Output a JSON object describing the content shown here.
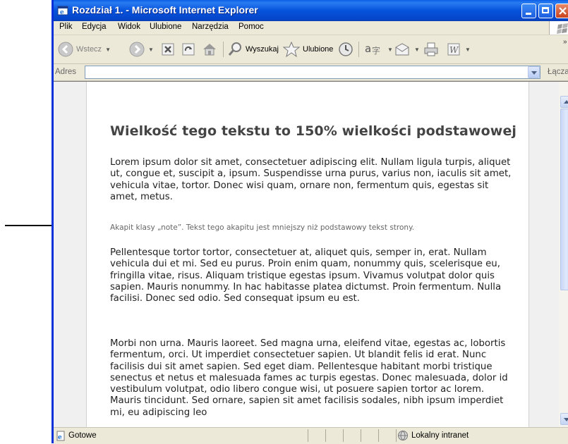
{
  "window": {
    "title": "Rozdział 1. - Microsoft Internet Explorer"
  },
  "menu": {
    "items": [
      "Plik",
      "Edycja",
      "Widok",
      "Ulubione",
      "Narzędzia",
      "Pomoc"
    ]
  },
  "toolbar": {
    "back_label": "Wstecz",
    "search_label": "Wyszukaj",
    "favorites_label": "Ulubione"
  },
  "address": {
    "label": "Adres",
    "value": "",
    "go_label": "Łącza"
  },
  "page": {
    "heading": "Wielkość tego tekstu to 150% wielkości podstawowej",
    "paragraph1": "Lorem ipsum dolor sit amet, consectetuer adipiscing elit. Nullam ligula turpis, aliquet ut, congue et, suscipit a, ipsum. Suspendisse urna purus, varius non, iaculis sit amet, vehicula vitae, tortor. Donec wisi quam, ornare non, fermentum quis, egestas sit amet, metus.",
    "note": "Akapit klasy „note”. Tekst tego akapitu jest mniejszy niż podstawowy tekst strony.",
    "paragraph2": "Pellentesque tortor tortor, consectetuer at, aliquet quis, semper in, erat. Nullam vehicula dui et mi. Sed eu purus. Proin enim quam, nonummy quis, scelerisque eu, fringilla vitae, risus. Aliquam tristique egestas ipsum. Vivamus volutpat dolor quis sapien. Mauris nonummy. In hac habitasse platea dictumst. Proin fermentum. Nulla facilisi. Donec sed odio. Sed consequat ipsum eu est.",
    "paragraph3": "Morbi non urna. Mauris laoreet. Sed magna urna, eleifend vitae, egestas ac, lobortis fermentum, orci. Ut imperdiet consectetuer sapien. Ut blandit felis id erat. Nunc facilisis dui sit amet sapien. Sed eget diam. Pellentesque habitant morbi tristique senectus et netus et malesuada fames ac turpis egestas. Donec malesuada, dolor id vestibulum volutpat, odio libero congue wisi, ut posuere sapien tortor ac lorem. Mauris tincidunt. Sed ornare, sapien sit amet facilisis sodales, nibh ipsum imperdiet mi, eu adipiscing leo"
  },
  "status": {
    "text": "Gotowe",
    "zone": "Lokalny intranet"
  },
  "colors": {
    "titlebar": "#0653dc",
    "chrome": "#ece9d8",
    "heading": "#444444"
  }
}
